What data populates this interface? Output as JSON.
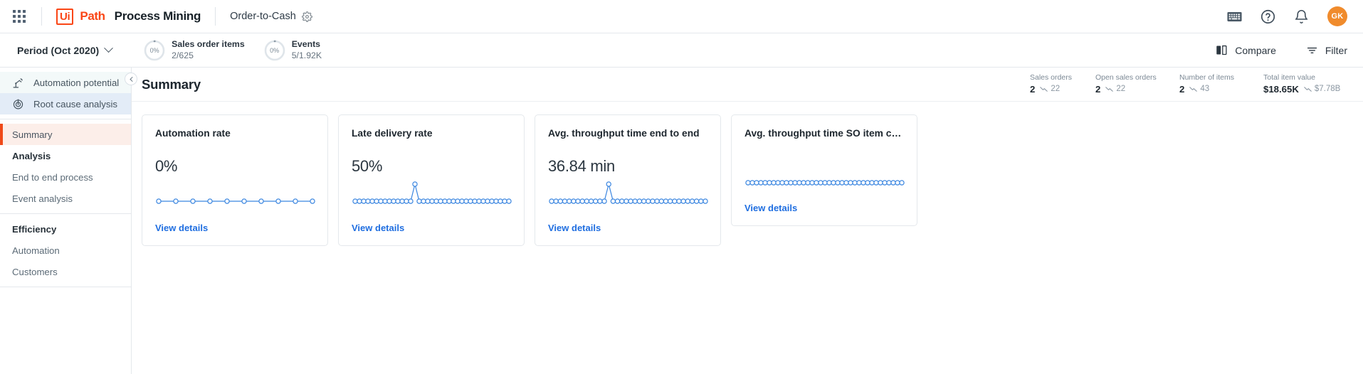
{
  "header": {
    "apps_icon": "apps-grid-icon",
    "brand_ui": "Ui",
    "brand_path": "Path",
    "brand_suffix": "Process Mining",
    "process_name": "Order-to-Cash",
    "gear_icon": "gear-icon",
    "keyboard_icon": "keyboard-icon",
    "help_icon": "help-circle-icon",
    "bell_icon": "notification-bell-icon",
    "avatar_initials": "GK",
    "avatar_color": "#f08b2c",
    "brand_color": "#fa4616"
  },
  "filterbar": {
    "period_label": "Period (Oct 2020)",
    "chevron_icon": "chevron-down-icon",
    "metrics": [
      {
        "percent": "0%",
        "title": "Sales order items",
        "sub": "2/625"
      },
      {
        "percent": "0%",
        "title": "Events",
        "sub": "5/1.92K"
      }
    ],
    "compare_label": "Compare",
    "compare_icon": "compare-icon",
    "filter_label": "Filter",
    "filter_icon": "filter-funnel-icon"
  },
  "sidebar": {
    "collapse_icon": "chevron-left-icon",
    "top_items": [
      {
        "label": "Automation potential",
        "icon": "robot-arm-icon"
      },
      {
        "label": "Root cause analysis",
        "icon": "target-bullseye-icon"
      }
    ],
    "nav_items": [
      {
        "label": "Summary",
        "type": "item",
        "active": true
      },
      {
        "label": "Analysis",
        "type": "head",
        "active": false
      },
      {
        "label": "End to end process",
        "type": "item",
        "active": false
      },
      {
        "label": "Event analysis",
        "type": "item",
        "active": false
      },
      {
        "label": "Efficiency",
        "type": "head",
        "active": false
      },
      {
        "label": "Automation",
        "type": "item",
        "active": false
      },
      {
        "label": "Customers",
        "type": "item",
        "active": false
      }
    ],
    "active_accent": "#ef4a19",
    "active_bg": "#fceee9"
  },
  "main": {
    "page_title": "Summary",
    "stats": [
      {
        "label": "Sales orders",
        "value": "2",
        "compare": "22"
      },
      {
        "label": "Open sales orders",
        "value": "2",
        "compare": "22"
      },
      {
        "label": "Number of items",
        "value": "2",
        "compare": "43"
      },
      {
        "label": "Total item value",
        "value": "$18.65K",
        "compare": "$7.78B"
      }
    ],
    "view_details_label": "View details",
    "cards": [
      {
        "title": "Automation rate",
        "value": "0%",
        "has_value": true,
        "chart_ref": 0
      },
      {
        "title": "Late delivery rate",
        "value": "50%",
        "has_value": true,
        "chart_ref": 1
      },
      {
        "title": "Avg. throughput time end to end",
        "value": "36.84 min",
        "has_value": true,
        "chart_ref": 2
      },
      {
        "title": "Avg. throughput time SO item cre…",
        "value": "",
        "has_value": false,
        "chart_ref": 3
      }
    ]
  },
  "chart_data": [
    {
      "type": "line",
      "title": "Automation rate",
      "series": [
        {
          "name": "Automation rate",
          "values": [
            0,
            0,
            0,
            0,
            0,
            0,
            0,
            0,
            0,
            0
          ]
        }
      ],
      "x": [
        1,
        2,
        3,
        4,
        5,
        6,
        7,
        8,
        9,
        10
      ],
      "ylim": [
        0,
        1
      ],
      "grid": false,
      "legend": "none",
      "color": "#3b86e0",
      "markers": "open-circle"
    },
    {
      "type": "line",
      "title": "Late delivery rate",
      "series": [
        {
          "name": "Late delivery rate",
          "values": [
            0,
            0,
            0,
            0,
            0,
            0,
            0,
            0,
            0,
            0,
            0,
            0,
            0,
            0,
            1,
            0,
            0,
            0,
            0,
            0,
            0,
            0,
            0,
            0,
            0,
            0,
            0,
            0,
            0,
            0,
            0,
            0,
            0,
            0,
            0,
            0,
            0
          ]
        }
      ],
      "x": [
        1,
        2,
        3,
        4,
        5,
        6,
        7,
        8,
        9,
        10,
        11,
        12,
        13,
        14,
        15,
        16,
        17,
        18,
        19,
        20,
        21,
        22,
        23,
        24,
        25,
        26,
        27,
        28,
        29,
        30,
        31,
        32,
        33,
        34,
        35,
        36,
        37
      ],
      "ylim": [
        0,
        1
      ],
      "grid": false,
      "legend": "none",
      "color": "#3b86e0",
      "markers": "open-circle"
    },
    {
      "type": "line",
      "title": "Avg. throughput time end to end",
      "series": [
        {
          "name": "Avg. throughput time end to end",
          "values": [
            0,
            0,
            0,
            0,
            0,
            0,
            0,
            0,
            0,
            0,
            0,
            0,
            0,
            1,
            0,
            0,
            0,
            0,
            0,
            0,
            0,
            0,
            0,
            0,
            0,
            0,
            0,
            0,
            0,
            0,
            0,
            0,
            0,
            0,
            0,
            0
          ]
        }
      ],
      "x": [
        1,
        2,
        3,
        4,
        5,
        6,
        7,
        8,
        9,
        10,
        11,
        12,
        13,
        14,
        15,
        16,
        17,
        18,
        19,
        20,
        21,
        22,
        23,
        24,
        25,
        26,
        27,
        28,
        29,
        30,
        31,
        32,
        33,
        34,
        35,
        36
      ],
      "ylim": [
        0,
        1
      ],
      "grid": false,
      "legend": "none",
      "color": "#3b86e0",
      "markers": "open-circle"
    },
    {
      "type": "line",
      "title": "Avg. throughput time SO item cre…",
      "series": [
        {
          "name": "Avg. throughput time SO item creation",
          "values": [
            0,
            0,
            0,
            0,
            0,
            0,
            0,
            0,
            0,
            0,
            0,
            0,
            0,
            0,
            0,
            0,
            0,
            0,
            0,
            0,
            0,
            0,
            0,
            0,
            0,
            0,
            0,
            0,
            0,
            0,
            0,
            0,
            0,
            0,
            0,
            0,
            0
          ]
        }
      ],
      "x": [
        1,
        2,
        3,
        4,
        5,
        6,
        7,
        8,
        9,
        10,
        11,
        12,
        13,
        14,
        15,
        16,
        17,
        18,
        19,
        20,
        21,
        22,
        23,
        24,
        25,
        26,
        27,
        28,
        29,
        30,
        31,
        32,
        33,
        34,
        35,
        36,
        37
      ],
      "ylim": [
        0,
        1
      ],
      "grid": false,
      "legend": "none",
      "color": "#3b86e0",
      "markers": "open-circle"
    }
  ]
}
